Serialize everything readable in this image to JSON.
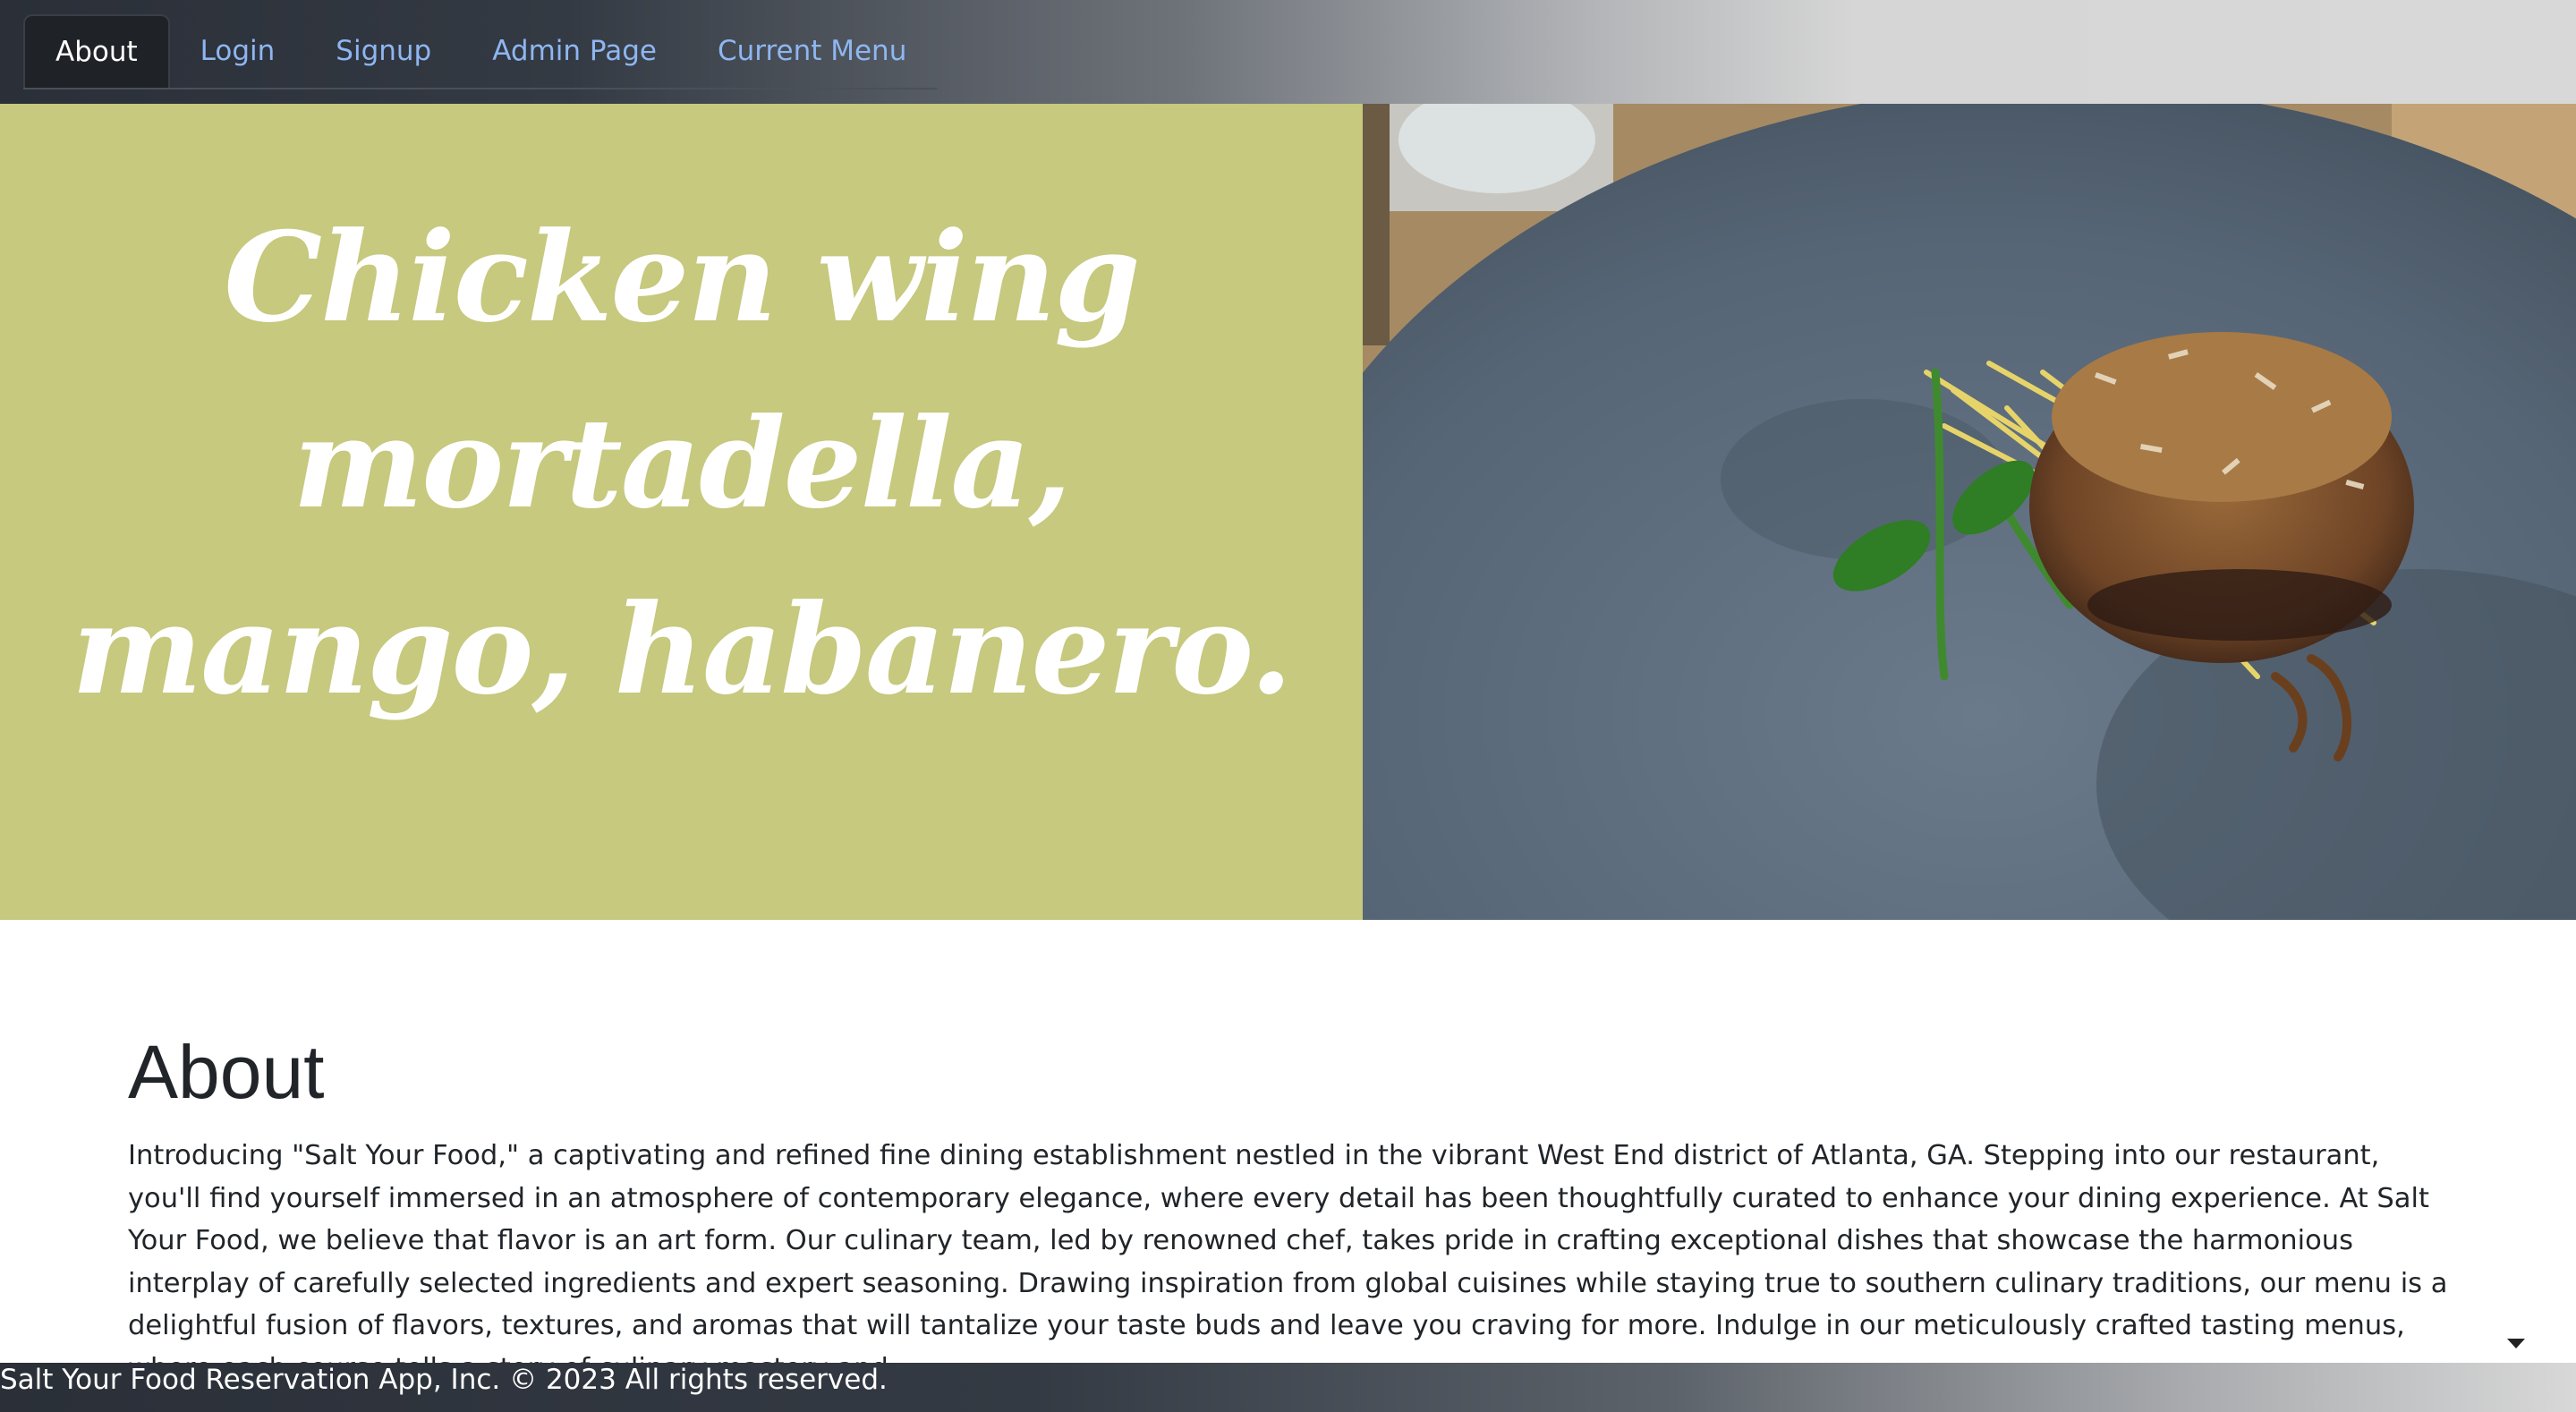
{
  "nav": {
    "tabs": [
      {
        "label": "About",
        "active": true
      },
      {
        "label": "Login",
        "active": false
      },
      {
        "label": "Signup",
        "active": false
      },
      {
        "label": "Admin Page",
        "active": false
      },
      {
        "label": "Current Menu",
        "active": false
      }
    ]
  },
  "hero": {
    "caption": "Chicken wing mortadella, mango, habanero.",
    "caption_panel_color": "#c6c97e",
    "image_icon": "plated-dish-photo",
    "indicators": [
      {
        "active": false
      },
      {
        "active": false
      },
      {
        "active": true
      },
      {
        "active": false
      }
    ],
    "avatar_icon": "user-icon"
  },
  "about": {
    "title": "About",
    "text": "Introducing \"Salt Your Food,\" a captivating and refined fine dining establishment nestled in the vibrant West End district of Atlanta, GA. Stepping into our restaurant, you'll find yourself immersed in an atmosphere of contemporary elegance, where every detail has been thoughtfully curated to enhance your dining experience. At Salt Your Food, we believe that flavor is an art form. Our culinary team, led by renowned chef, takes pride in crafting exceptional dishes that showcase the harmonious interplay of carefully selected ingredients and expert seasoning. Drawing inspiration from global cuisines while staying true to southern culinary traditions, our menu is a delightful fusion of flavors, textures, and aromas that will tantalize your taste buds and leave you craving for more. Indulge in our meticulously crafted tasting menus, where each course tells a story of culinary mastery and"
  },
  "footer": {
    "text": "Salt Your Food Reservation App, Inc. © 2023 All rights reserved."
  }
}
